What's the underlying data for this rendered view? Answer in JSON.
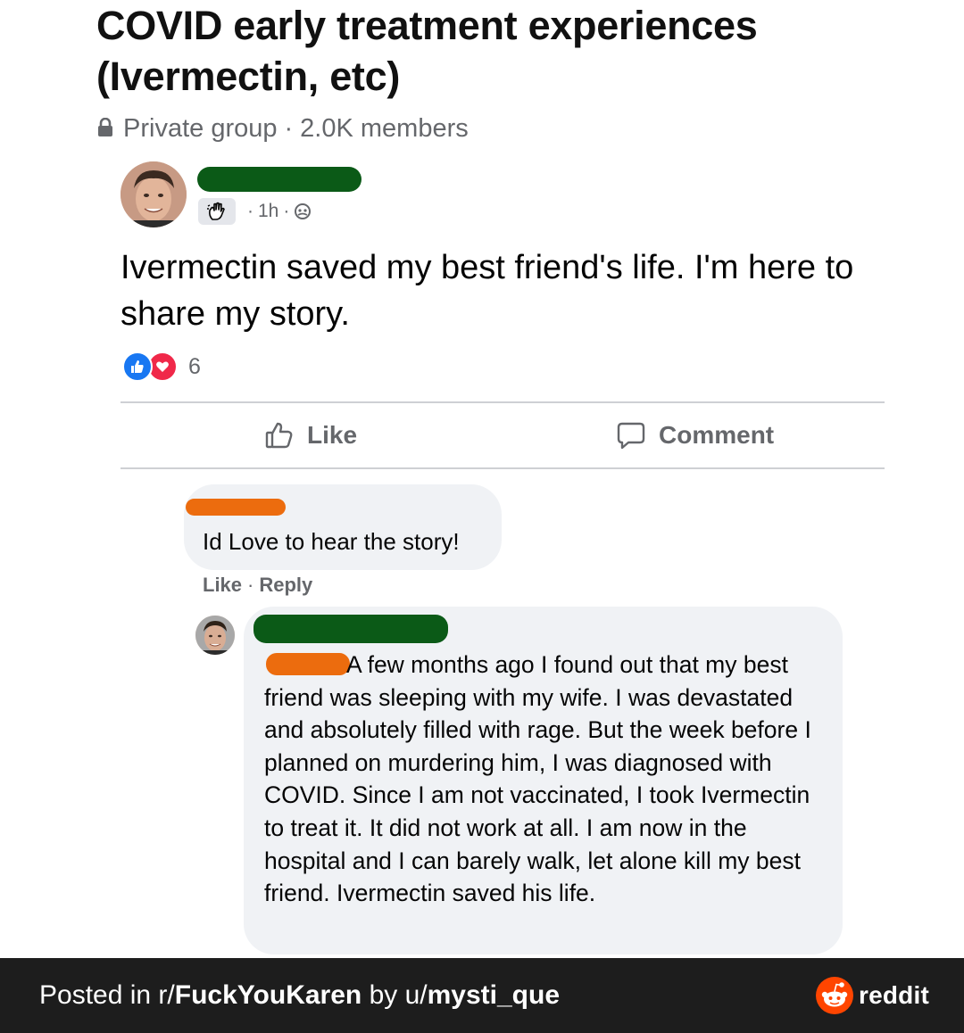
{
  "group": {
    "title": "COVID early treatment experiences (Ivermectin, etc)",
    "privacy": "Private group",
    "separator": "·",
    "members": "2.0K members"
  },
  "post": {
    "time": "1h",
    "dot": "·",
    "text": "Ivermectin saved my best friend's life. I'm here to share my story.",
    "reaction_count": "6"
  },
  "actions": {
    "like_label": "Like",
    "comment_label": "Comment"
  },
  "comment": {
    "text": "Id Love to hear the story!",
    "like_label": "Like",
    "dot": "·",
    "reply_label": "Reply"
  },
  "reply": {
    "text": "A few months ago I found out that my best friend was sleeping with my wife. I was devastated and absolutely filled with rage. But the week before I planned on murdering him, I was diagnosed with COVID. Since I am not vaccinated, I took Ivermectin to treat it. It did not work at all. I am now in the hospital and I can barely walk, let alone kill my best friend. Ivermectin saved his life."
  },
  "footer": {
    "posted_in": "Posted in r/",
    "subreddit": "FuckYouKaren",
    "by": " by u/",
    "username": "mysti_que",
    "brand": "reddit"
  },
  "icons": {
    "lock": "lock-icon",
    "wave_badge": "wave-hand-icon",
    "globe": "globe-icon",
    "like_reaction": "thumbs-up-reaction-icon",
    "love_reaction": "heart-reaction-icon",
    "like_action": "thumbs-up-icon",
    "comment_action": "speech-bubble-icon",
    "reddit_logo": "reddit-snoo-icon"
  },
  "colors": {
    "redaction_green": "#0b5a17",
    "redaction_orange": "#ec6c0e",
    "like_blue": "#1877f2",
    "love_red": "#f02849",
    "reddit_orange": "#ff4500",
    "footer_bg": "#1d1d1d"
  }
}
